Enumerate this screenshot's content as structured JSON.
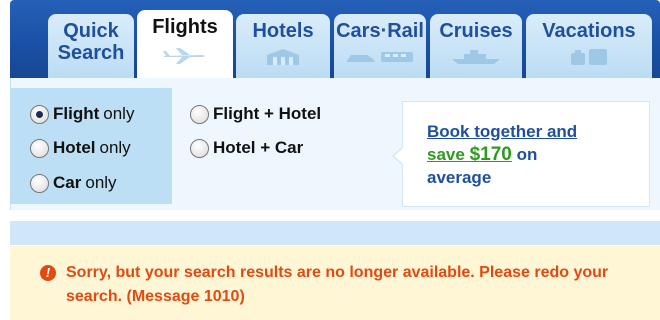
{
  "tabs": [
    {
      "line1": "Quick",
      "line2": "Search",
      "icon": "search-icon",
      "active": false
    },
    {
      "line1": "Flights",
      "line2": "",
      "icon": "plane-icon",
      "active": true
    },
    {
      "line1": "Hotels",
      "line2": "",
      "icon": "hotel-icon",
      "active": false
    },
    {
      "line1": "Cars·Rail",
      "line2": "",
      "icon": "car-train-icon",
      "active": false
    },
    {
      "line1": "Cruises",
      "line2": "",
      "icon": "ship-icon",
      "active": false
    },
    {
      "line1": "Vacations",
      "line2": "",
      "icon": "luggage-icon",
      "active": false
    }
  ],
  "options": {
    "flight_only": {
      "bold": "Flight",
      "suffix": "only",
      "checked": true
    },
    "hotel_only": {
      "bold": "Hotel",
      "suffix": "only",
      "checked": false
    },
    "car_only": {
      "bold": "Car",
      "suffix": "only",
      "checked": false
    },
    "flight_hotel": {
      "bold": "Flight + Hotel",
      "checked": false
    },
    "hotel_car": {
      "bold": "Hotel + Car",
      "checked": false
    }
  },
  "promo": {
    "line1": "Book together and",
    "save": "save",
    "amount": "$170",
    "on": "on",
    "average": "average"
  },
  "error": {
    "message": "Sorry, but your search results are no longer available. Please redo your search. (Message 1010)"
  },
  "colors": {
    "tabbar": "#1a4fa3",
    "tab": "#bcdcf4",
    "link": "#1f4f9f",
    "save": "#2e9b1f",
    "error": "#e24a12",
    "error_bg": "#fff6d6"
  }
}
